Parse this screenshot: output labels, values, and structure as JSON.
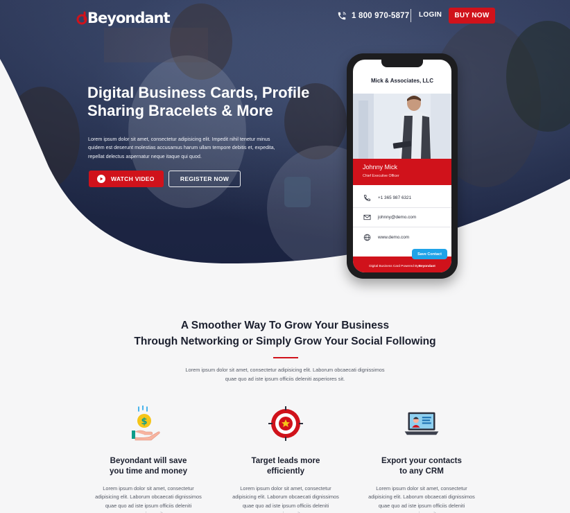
{
  "header": {
    "logo_text": "Beyondant",
    "phone": "1 800 970-5877",
    "login_label": "LOGIN",
    "buy_label": "BUY NOW"
  },
  "hero": {
    "title_line1": "Digital Business Cards, Profile",
    "title_line2": "Sharing Bracelets & More",
    "description": "Lorem ipsum dolor sit amet, consectetur adipisicing elit. Impedit nihil tenetur minus quidem est deserunt molestias accusamus harum ullam tempore debitis et, expedita, repellat delectus aspernatur neque itaque qui quod.",
    "watch_label": "WATCH VIDEO",
    "register_label": "REGISTER NOW"
  },
  "card": {
    "company": "Mick & Associates, LLC",
    "name": "Johnny Mick",
    "role": "Chief Executive Officer",
    "phone": "+1 365 987 6321",
    "email": "johnny@demo.com",
    "website": "www.demo.com",
    "save_label": "Save Contact",
    "footer_prefix": "Digital Business Card Powered By ",
    "footer_brand": "Beyondant"
  },
  "section": {
    "title_line1": "A Smoother Way To Grow Your Business",
    "title_line2": "Through Networking or Simply Grow Your Social Following",
    "description": "Lorem ipsum dolor sit amet, consectetur adipisicing elit. Laborum obcaecati dignissimos quae quo ad iste ipsum officiis deleniti asperiores sit."
  },
  "features": [
    {
      "icon": "money-hand-icon",
      "title_line1": "Beyondant will save",
      "title_line2": "you time and money",
      "description": "Lorem ipsum dolor sit amet, consectetur adipisicing elit. Laborum obcaecati dignissimos quae quo ad iste ipsum officiis deleniti asperiores sit."
    },
    {
      "icon": "target-icon",
      "title_line1": "Target leads more",
      "title_line2": "efficiently",
      "description": "Lorem ipsum dolor sit amet, consectetur adipisicing elit. Laborum obcaecati dignissimos quae quo ad iste ipsum officiis deleniti asperiores sit."
    },
    {
      "icon": "laptop-contact-icon",
      "title_line1": "Export your contacts",
      "title_line2": "to any CRM",
      "description": "Lorem ipsum dolor sit amet, consectetur adipisicing elit. Laborum obcaecati dignissimos quae quo ad iste ipsum officiis deleniti asperiores sit."
    }
  ],
  "colors": {
    "brand_red": "#d0121b",
    "hero_navy": "#1e2744",
    "save_blue": "#1fa3e8"
  }
}
